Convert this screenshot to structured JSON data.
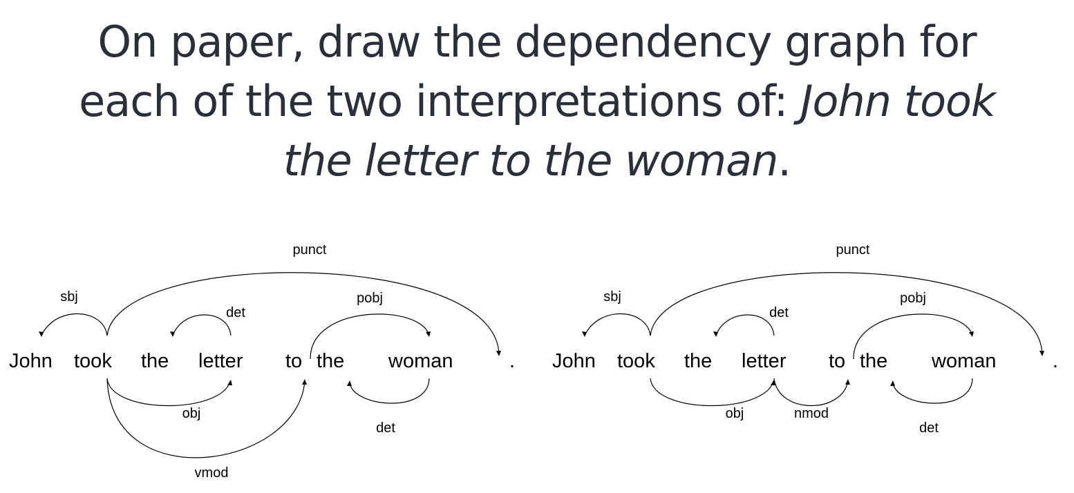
{
  "title": {
    "line1": "On paper, draw the dependency graph for",
    "line2_plain": "each of the two interpretations of: ",
    "line2_italic": "John took",
    "line3_italic": "the letter to the woman",
    "line3_end": "."
  },
  "graphs": [
    {
      "words": [
        "John",
        "took",
        "the",
        "letter",
        "to",
        "the",
        "woman",
        "."
      ],
      "relations": [
        "sbj",
        "det",
        "pobj",
        "punct",
        "obj",
        "det",
        "vmod"
      ]
    },
    {
      "words": [
        "John",
        "took",
        "the",
        "letter",
        "to",
        "the",
        "woman",
        "."
      ],
      "relations": [
        "sbj",
        "det",
        "pobj",
        "punct",
        "obj",
        "nmod",
        "det"
      ]
    }
  ]
}
